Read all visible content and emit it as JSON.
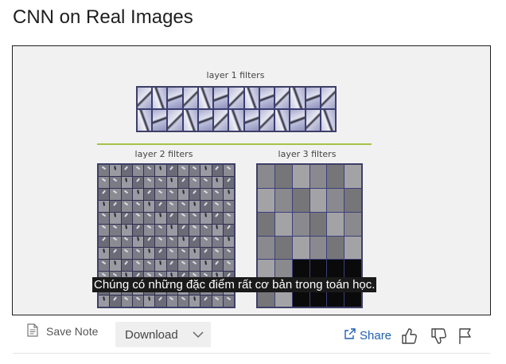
{
  "page": {
    "title": "CNN on Real Images"
  },
  "slide": {
    "layer1_label": "layer 1 filters",
    "layer2_label": "layer 2 filters",
    "layer3_label": "layer 3 filters",
    "accent_line_color": "#a6c24a"
  },
  "subtitle": {
    "text": "Chúng có những đặc điểm rất cơ bản trong toán học."
  },
  "toolbar": {
    "save_note_label": "Save Note",
    "download_label": "Download",
    "share_label": "Share",
    "icons": [
      "note-icon",
      "chevron-down-icon",
      "share-icon",
      "thumbs-up-icon",
      "thumbs-down-icon",
      "flag-icon"
    ]
  },
  "colors": {
    "link": "#1f5fb4",
    "caption_bg": "#1a1a1a"
  }
}
